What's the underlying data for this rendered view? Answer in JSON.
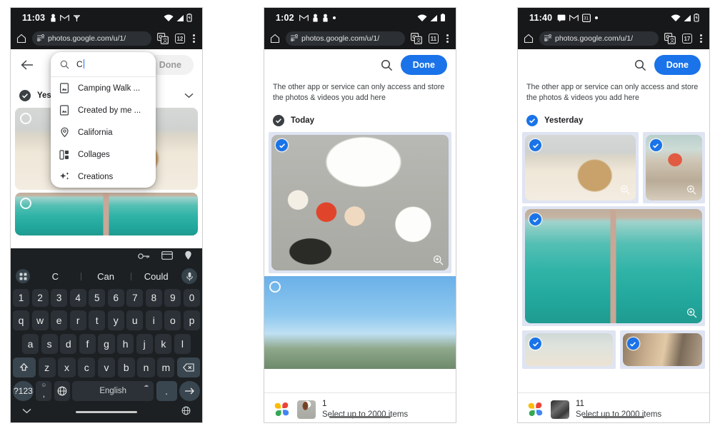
{
  "panels": [
    {
      "id": "panel-1",
      "status": {
        "time": "11:03",
        "icons": [
          "person-icon",
          "gmail-icon",
          "antenna-icon"
        ],
        "right_icons": [
          "wifi-icon",
          "signal-icon",
          "battery-icon"
        ]
      },
      "browser": {
        "url": "photos.google.com/u/1/",
        "translate_icon": "google-translate-icon",
        "tab_count": "12",
        "menu_icon": "overflow-menu-icon"
      },
      "app": {
        "back_icon": "back-arrow-icon",
        "date_label": "Yeste",
        "done_label": "Done",
        "done_disabled": true
      },
      "dropdown": {
        "search_icon": "search-icon",
        "query": "C",
        "items": [
          {
            "icon": "photo-album-icon",
            "label": "Camping Walk ..."
          },
          {
            "icon": "photo-album-icon",
            "label": "Created by me ..."
          },
          {
            "icon": "location-pin-icon",
            "label": "California"
          },
          {
            "icon": "collage-icon",
            "label": "Collages"
          },
          {
            "icon": "sparkle-icon",
            "label": "Creations"
          }
        ]
      },
      "keyboard": {
        "toolbar_icons": [
          "key-icon",
          "card-icon",
          "location-pin-icon"
        ],
        "grid_icon": "grid-icon",
        "mic_icon": "microphone-icon",
        "suggestions": [
          "C",
          "Can",
          "Could"
        ],
        "row_numbers": [
          "1",
          "2",
          "3",
          "4",
          "5",
          "6",
          "7",
          "8",
          "9",
          "0"
        ],
        "row_q": [
          "q",
          "w",
          "e",
          "r",
          "t",
          "y",
          "u",
          "i",
          "o",
          "p"
        ],
        "row_a": [
          "a",
          "s",
          "d",
          "f",
          "g",
          "h",
          "j",
          "k",
          "l"
        ],
        "row_z": [
          "z",
          "x",
          "c",
          "v",
          "b",
          "n",
          "m"
        ],
        "shift_icon": "shift-icon",
        "backspace_icon": "backspace-icon",
        "symbols_key": "?123",
        "comma_key": ",",
        "comma_sup": "☺",
        "globe_icon": "globe-icon",
        "space_label": "English",
        "period_key": ".",
        "enter_icon": "enter-arrow-icon",
        "nav_back_icon": "chevron-down-icon",
        "nav_globe_icon": "globe-icon"
      }
    },
    {
      "id": "panel-2",
      "status": {
        "time": "1:02",
        "icons": [
          "gmail-icon",
          "person-icon",
          "person-icon",
          "dot-icon"
        ],
        "right_icons": [
          "wifi-icon",
          "signal-icon",
          "battery-icon"
        ]
      },
      "browser": {
        "url": "photos.google.com/u/1/",
        "translate_icon": "google-translate-icon",
        "tab_count": "11",
        "menu_icon": "overflow-menu-icon"
      },
      "app": {
        "search_icon": "search-icon",
        "done_label": "Done",
        "done_disabled": false,
        "notice": "The other app or service can only access and store the photos & videos you add here",
        "date_label": "Today",
        "date_selected": false
      },
      "photos": [
        {
          "name": "korean-food-platter",
          "selected": true,
          "art": "ph-food"
        },
        {
          "name": "city-skyline",
          "selected": false,
          "art": "ph-city"
        }
      ],
      "bottom": {
        "logo": "google-photos-logo",
        "thumb": "selected-photo-thumbnail",
        "count": "1",
        "subtitle": "Select up to 2000 items"
      }
    },
    {
      "id": "panel-3",
      "status": {
        "time": "11:40",
        "icons": [
          "chat-icon",
          "gmail-icon",
          "calendar-icon",
          "dot-icon"
        ],
        "right_icons": [
          "wifi-icon",
          "signal-icon",
          "battery-icon"
        ]
      },
      "browser": {
        "url": "photos.google.com/u/1/",
        "translate_icon": "google-translate-icon",
        "tab_count": "17",
        "menu_icon": "overflow-menu-icon"
      },
      "app": {
        "search_icon": "search-icon",
        "done_label": "Done",
        "done_disabled": false,
        "notice": "The other app or service can only access and store the photos & videos you add here",
        "date_label": "Yesterday",
        "date_selected": true
      },
      "photos": [
        {
          "name": "beach-bag-sandals",
          "selected": true,
          "art": "ph-beach-bag"
        },
        {
          "name": "rocks-red-cloth",
          "selected": true,
          "art": "ph-rocks"
        },
        {
          "name": "aerial-turquoise-sea-pier",
          "selected": true,
          "art": "ph-aerial-sea"
        },
        {
          "name": "sand-shoreline",
          "selected": true,
          "art": "ph-sand-bar"
        },
        {
          "name": "indoor-scene",
          "selected": true,
          "art": "ph-indoor"
        }
      ],
      "bottom": {
        "logo": "google-photos-logo",
        "thumb": "selected-photo-thumbnail",
        "count": "11",
        "subtitle": "Select up to 2000 items"
      }
    }
  ],
  "colors": {
    "accent_blue": "#1a73e8",
    "status_bar": "#17181a",
    "keyboard_bg": "#1c2023",
    "key_bg": "#2b3136",
    "key_mod_bg": "#39464f",
    "selection_frame": "#dfe4f2"
  }
}
